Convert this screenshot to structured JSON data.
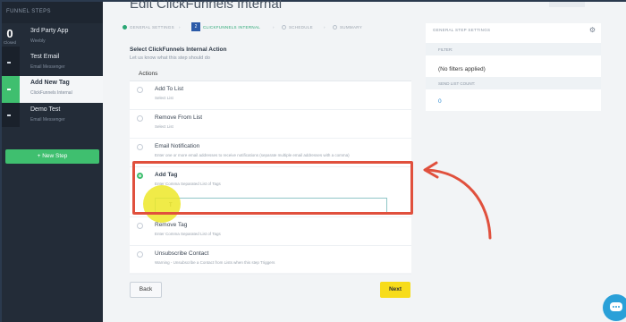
{
  "sidebar": {
    "header": "FUNNEL STEPS",
    "count_value": "0",
    "count_label": "Closed",
    "steps": [
      {
        "title": "3rd Party App",
        "subtitle": "Weebly"
      },
      {
        "title": "Test Email",
        "subtitle": "Email Messenger"
      },
      {
        "title": "Add New Tag",
        "subtitle": "ClickFunnels Internal"
      },
      {
        "title": "Demo Test",
        "subtitle": "Email Messenger"
      }
    ],
    "new_step_label": "+  New Step"
  },
  "main": {
    "title": "Edit ClickFunnels Internal",
    "stepper": {
      "step1": "GENERAL SETTINGS",
      "step2": "CLICKFUNNELS INTERNAL",
      "step3": "SCHEDULE",
      "step4": "SUMMARY",
      "step2_badge": "2"
    },
    "section_title": "Select ClickFunnels Internal Action",
    "section_sub": "Let us know what this step should do",
    "actions_label": "Actions",
    "options": [
      {
        "title": "Add To List",
        "sub": "Select List"
      },
      {
        "title": "Remove From List",
        "sub": "Select List"
      },
      {
        "title": "Email Notification",
        "sub": "Enter one or more email addresses to receive notifications (separate multiple email addresses with a comma)"
      },
      {
        "title": "Add Tag",
        "sub": "Enter Comma Separated List of Tags"
      },
      {
        "title": "Remove Tag",
        "sub": "Enter Comma Separated List of Tags"
      },
      {
        "title": "Unsubscribe Contact",
        "sub": "Warning - Unsubscribe a Contact from Lists when this step Triggers"
      }
    ],
    "tag_input_value": "T",
    "selected_option": "Add Tag",
    "back_label": "Back",
    "next_label": "Next"
  },
  "right_panel": {
    "header": "GENERAL STEP SETTINGS",
    "filter_label": "FILTER:",
    "filter_value": "(No filters applied)",
    "count_label": "SEND LIST COUNT:",
    "count_value": "0"
  },
  "colors": {
    "accent_green": "#3fbf6f",
    "annotation_red": "#e0503d",
    "next_yellow": "#f7dc1b",
    "chat_blue": "#2aa0d8"
  },
  "icons": {
    "settings": "gear-icon",
    "chat": "chat-bubble-icon",
    "annotation": "curved-arrow-icon"
  }
}
